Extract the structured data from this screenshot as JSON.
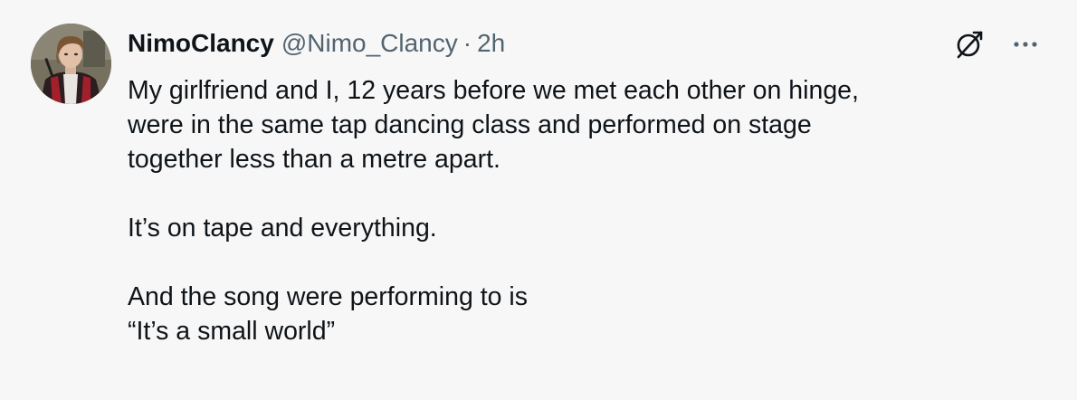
{
  "tweet": {
    "author": {
      "display_name": "NimoClancy",
      "handle": "@Nimo_Clancy",
      "avatar": "profile-photo"
    },
    "separator": "·",
    "time": "2h",
    "actions": {
      "grok_icon": "slashed-circle-icon",
      "more_icon": "more-dots-icon",
      "more_label": "···"
    },
    "paragraphs": [
      "My girlfriend and I, 12 years before we met each other on hinge,\nwere in the same tap dancing class and performed on stage\ntogether less than a metre apart.",
      "It’s on tape and everything.",
      "And the song were performing to is\n“It’s a small world”"
    ]
  },
  "colors": {
    "background": "#f7f7f7",
    "text_primary": "#0f1419",
    "text_secondary": "#536471"
  }
}
